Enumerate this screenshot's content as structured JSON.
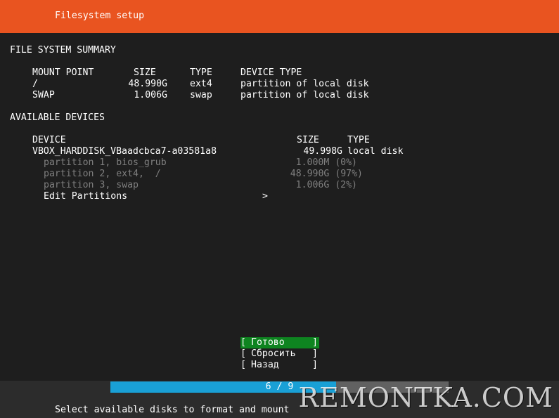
{
  "header": {
    "title": "Filesystem setup"
  },
  "summary": {
    "heading": "FILE SYSTEM SUMMARY",
    "columns": [
      "MOUNT POINT",
      "SIZE",
      "TYPE",
      "DEVICE TYPE"
    ],
    "rows": [
      [
        "/",
        "48.990G",
        "ext4",
        "partition of local disk"
      ],
      [
        "SWAP",
        "1.006G",
        "swap",
        "partition of local disk"
      ]
    ]
  },
  "devices": {
    "heading": "AVAILABLE DEVICES",
    "columns": [
      "DEVICE",
      "SIZE",
      "TYPE"
    ],
    "disk": {
      "name": "VBOX_HARDDISK_VBaadcbca7-a03581a8",
      "size": "49.998G",
      "type": "local disk"
    },
    "partitions": [
      {
        "name": "partition 1, bios_grub",
        "size": "1.000M (0%)"
      },
      {
        "name": "partition 2, ext4,  /",
        "size": "48.990G (97%)"
      },
      {
        "name": "partition 3, swap",
        "size": "1.006G (2%)"
      }
    ],
    "edit_label": "Edit Partitions",
    "edit_arrow": ">"
  },
  "buttons": {
    "bracket_open": "[",
    "bracket_close": "]",
    "done": "Готово",
    "reset": "Сбросить",
    "back": "Назад"
  },
  "progress": {
    "text": "6 / 9",
    "fraction": 0.667
  },
  "status_text": "Select available disks to format and mount",
  "watermark": "REMONTKA.COM",
  "colors": {
    "header": "#e95420",
    "background": "#1e1e1e",
    "active_button": "#0e8420",
    "progress_fill": "#19a0d6",
    "dim_text": "#7f7f7f"
  }
}
